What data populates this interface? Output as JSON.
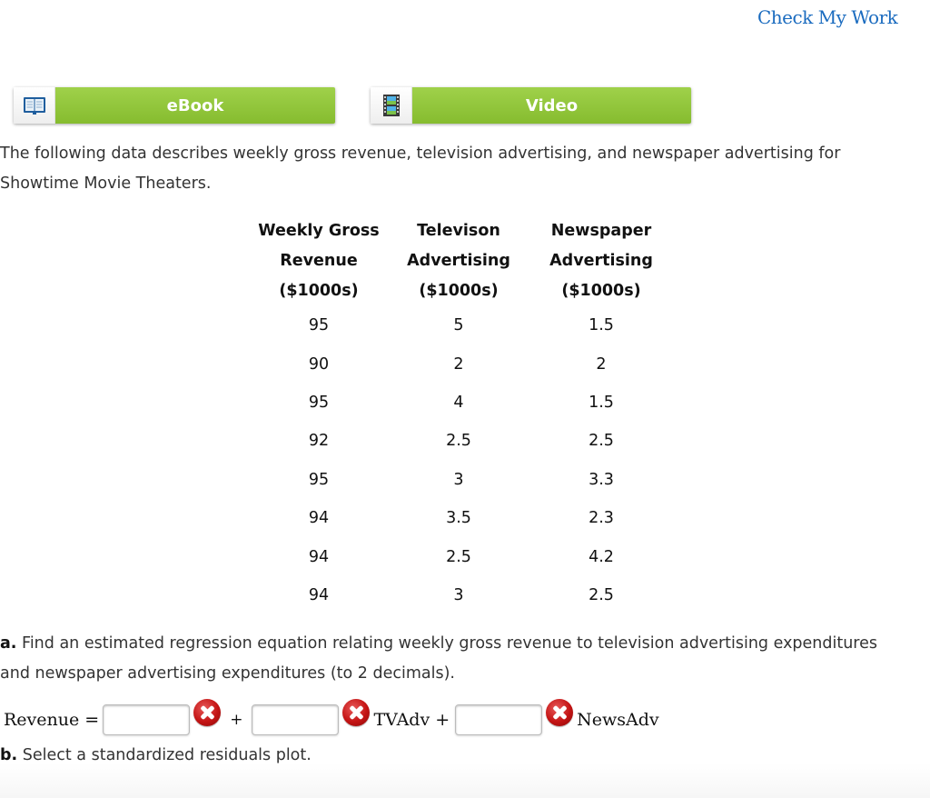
{
  "header": {
    "check_my_work": "Check My Work"
  },
  "resources": [
    {
      "label": "eBook",
      "icon": "book-icon"
    },
    {
      "label": "Video",
      "icon": "film-icon"
    }
  ],
  "intro_text": "The following data describes weekly gross revenue, television advertising, and newspaper advertising for Showtime Movie Theaters.",
  "table": {
    "headers": [
      [
        "Weekly Gross",
        "Revenue",
        "($1000s)"
      ],
      [
        "Televison",
        "Advertising",
        "($1000s)"
      ],
      [
        "Newspaper",
        "Advertising",
        "($1000s)"
      ]
    ],
    "rows": [
      [
        "95",
        "5",
        "1.5"
      ],
      [
        "90",
        "2",
        "2"
      ],
      [
        "95",
        "4",
        "1.5"
      ],
      [
        "92",
        "2.5",
        "2.5"
      ],
      [
        "95",
        "3",
        "3.3"
      ],
      [
        "94",
        "3.5",
        "2.3"
      ],
      [
        "94",
        "2.5",
        "4.2"
      ],
      [
        "94",
        "3",
        "2.5"
      ]
    ]
  },
  "question_a": {
    "label": "a.",
    "text": " Find an estimated regression equation relating weekly gross revenue to television advertising expenditures and newspaper advertising expenditures (to 2 decimals)."
  },
  "equation": {
    "lhs": "Revenue =",
    "plus1": "+",
    "term1": "TVAdv +",
    "term2": "NewsAdv",
    "inputs": [
      "",
      "",
      ""
    ]
  },
  "question_b": {
    "label": "b.",
    "text": " Select a standardized residuals plot."
  }
}
